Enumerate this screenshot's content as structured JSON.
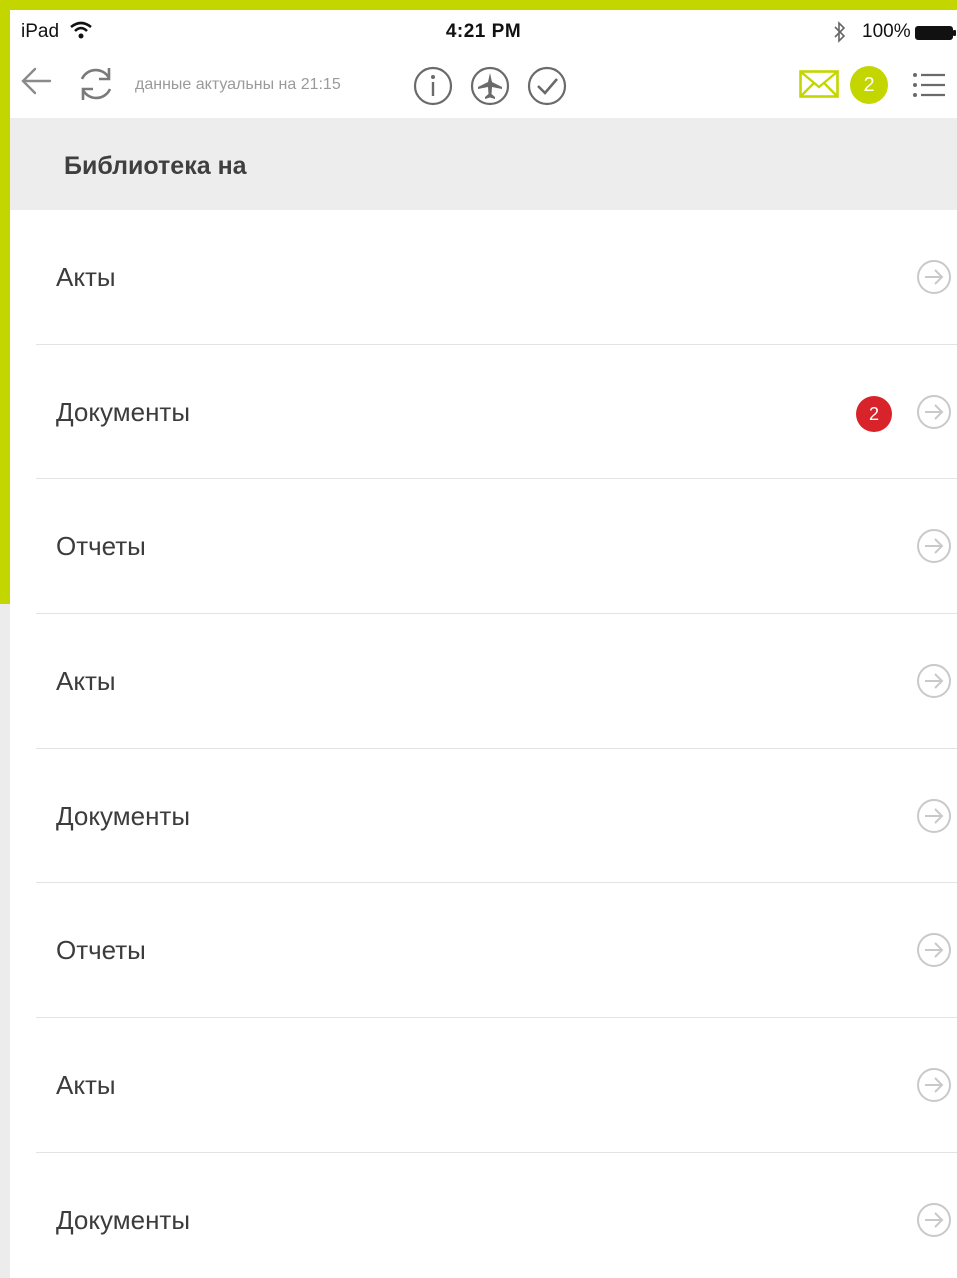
{
  "status_bar": {
    "device": "iPad",
    "time": "4:21 PM",
    "battery": "100%"
  },
  "toolbar": {
    "sync_status": "данные актуальны на 21:15",
    "mail_count": "2"
  },
  "colors": {
    "accent": "#c3d600",
    "badge_red": "#d8232a"
  },
  "section": {
    "title": "Библиотека на"
  },
  "list": {
    "items": [
      {
        "label": "Акты",
        "badge": ""
      },
      {
        "label": "Документы",
        "badge": "2"
      },
      {
        "label": "Отчеты",
        "badge": ""
      },
      {
        "label": "Акты",
        "badge": ""
      },
      {
        "label": "Документы",
        "badge": ""
      },
      {
        "label": "Отчеты",
        "badge": ""
      },
      {
        "label": "Акты",
        "badge": ""
      },
      {
        "label": "Документы",
        "badge": ""
      }
    ]
  }
}
